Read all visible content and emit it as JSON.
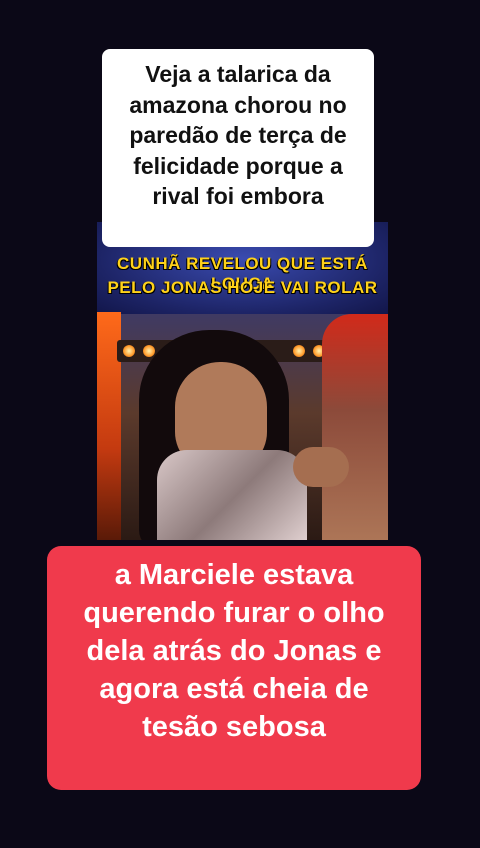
{
  "top_caption": {
    "lines": [
      "Veja a talarica da",
      "amazona chorou no",
      "paredão de terça de",
      "felicidade porque a",
      "rival foi embora"
    ]
  },
  "video": {
    "banner_line_1": "CUNHÃ REVELOU QUE ESTÁ LOUCA",
    "banner_line_2": "PELO JONAS HOJE VAI ROLAR"
  },
  "bottom_caption": {
    "lines": [
      "a Marciele estava",
      "querendo furar o olho",
      "dela atrás do Jonas e",
      "agora está cheia de",
      "tesão sebosa"
    ]
  },
  "colors": {
    "background": "#0b0817",
    "top_caption_bg": "#ffffff",
    "bottom_caption_bg": "#f03a4c",
    "banner_text": "#ffd21a"
  }
}
